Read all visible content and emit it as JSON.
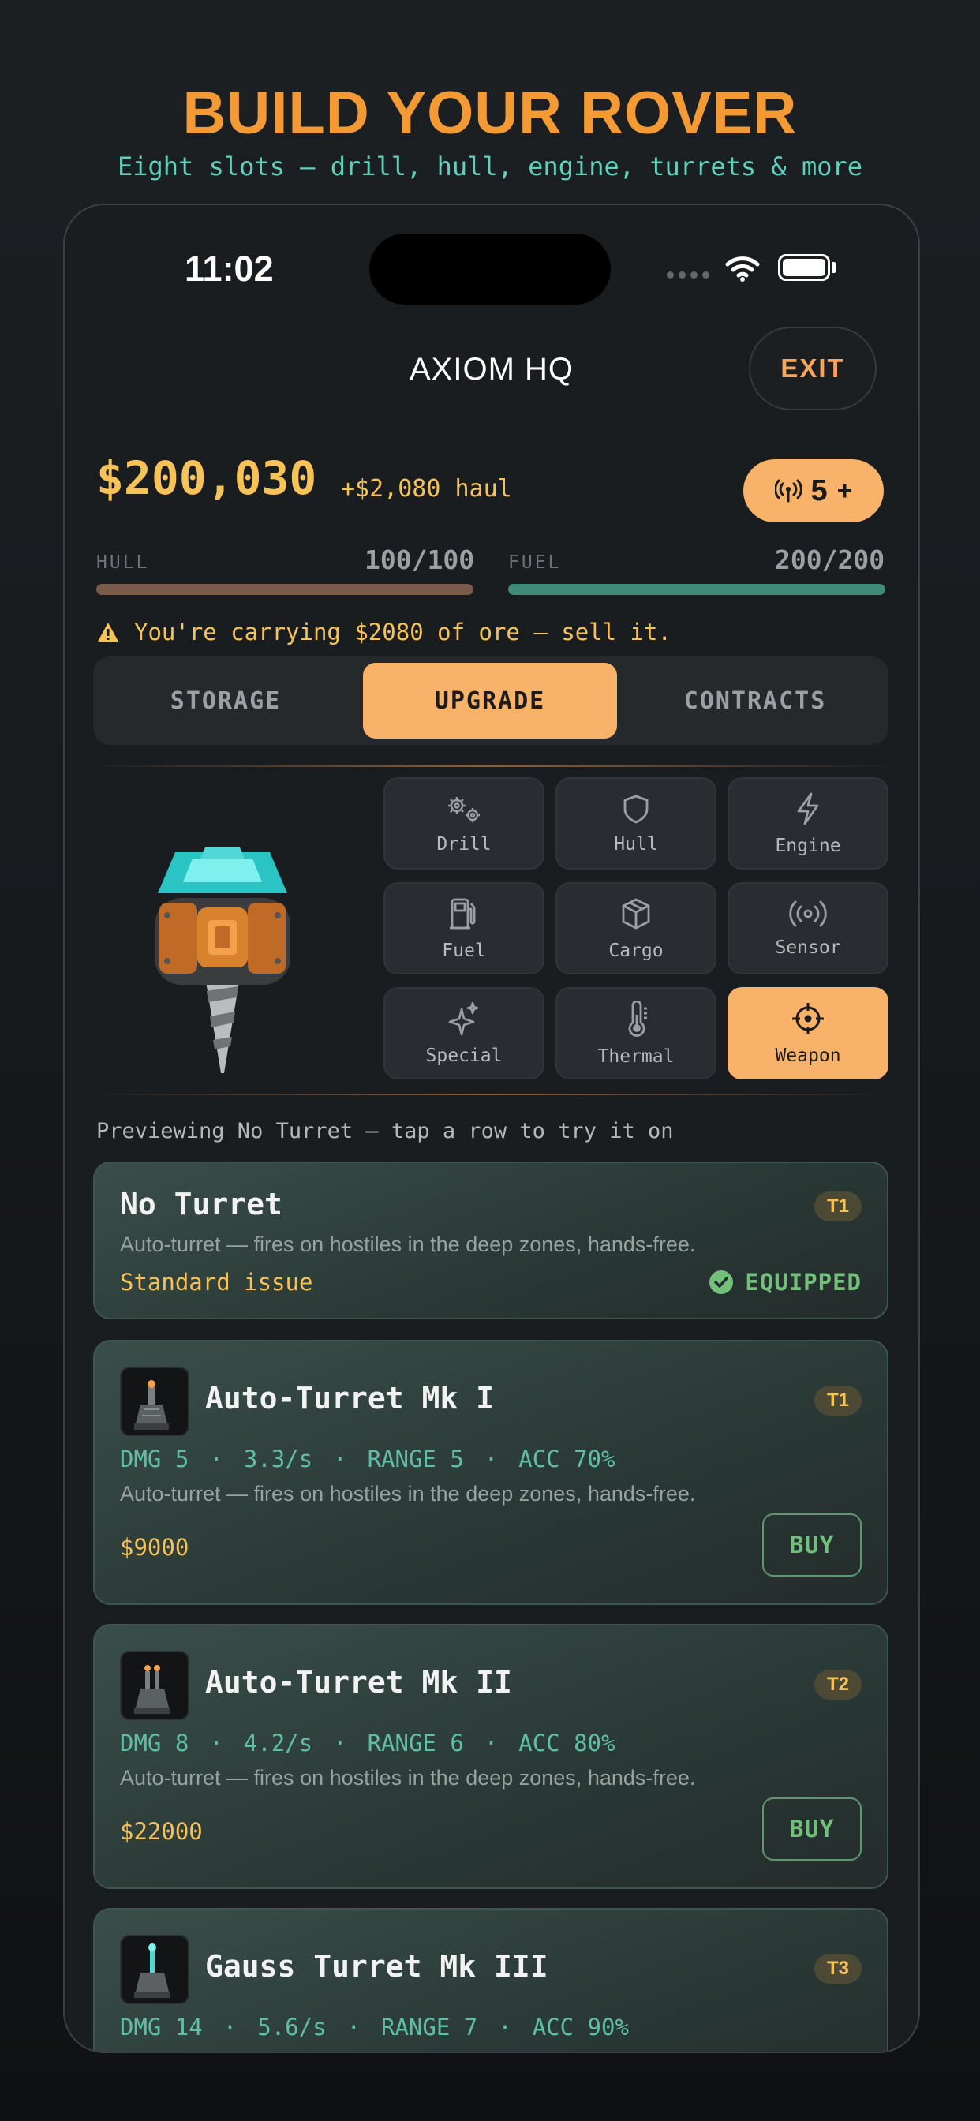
{
  "promo": {
    "title": "BUILD YOUR ROVER",
    "subtitle": "Eight slots — drill, hull, engine, turrets & more"
  },
  "status_bar": {
    "time": "11:02"
  },
  "nav": {
    "title": "AXIOM HQ",
    "exit_label": "EXIT"
  },
  "wallet": {
    "balance": "$200,030",
    "haul": "+$2,080 haul",
    "signal_count": "5",
    "signal_plus": "+"
  },
  "meters": {
    "hull": {
      "label": "HULL",
      "value": "100/100",
      "fraction": 1.0,
      "color": "#7a5a4a"
    },
    "fuel": {
      "label": "FUEL",
      "value": "200/200",
      "fraction": 1.0,
      "color": "#3f8a78"
    }
  },
  "warning": {
    "text": "You're carrying $2080 of ore — sell it.",
    "icon": "warning-triangle-icon"
  },
  "tabs": [
    {
      "label": "STORAGE",
      "active": false
    },
    {
      "label": "UPGRADE",
      "active": true
    },
    {
      "label": "CONTRACTS",
      "active": false
    }
  ],
  "slots": [
    {
      "label": "Drill",
      "icon": "gears-icon",
      "active": false
    },
    {
      "label": "Hull",
      "icon": "shield-icon",
      "active": false
    },
    {
      "label": "Engine",
      "icon": "lightning-icon",
      "active": false
    },
    {
      "label": "Fuel",
      "icon": "fuel-pump-icon",
      "active": false
    },
    {
      "label": "Cargo",
      "icon": "box-icon",
      "active": false
    },
    {
      "label": "Sensor",
      "icon": "broadcast-icon",
      "active": false
    },
    {
      "label": "Special",
      "icon": "sparkle-icon",
      "active": false
    },
    {
      "label": "Thermal",
      "icon": "thermometer-icon",
      "active": false
    },
    {
      "label": "Weapon",
      "icon": "crosshair-icon",
      "active": true
    }
  ],
  "preview_text": "Previewing No Turret — tap a row to try it on",
  "items": [
    {
      "name": "No Turret",
      "tier": "T1",
      "description": "Auto-turret — fires on hostiles in the deep zones, hands-free.",
      "price": "Standard issue",
      "status": "EQUIPPED"
    },
    {
      "name": "Auto-Turret Mk I",
      "tier": "T1",
      "stats": {
        "dmg": "DMG 5",
        "rate": "3.3/s",
        "range": "RANGE 5",
        "acc": "ACC 70%"
      },
      "description": "Auto-turret — fires on hostiles in the deep zones, hands-free.",
      "price": "$9000",
      "action": "BUY"
    },
    {
      "name": "Auto-Turret Mk II",
      "tier": "T2",
      "stats": {
        "dmg": "DMG 8",
        "rate": "4.2/s",
        "range": "RANGE 6",
        "acc": "ACC 80%"
      },
      "description": "Auto-turret — fires on hostiles in the deep zones, hands-free.",
      "price": "$22000",
      "action": "BUY"
    },
    {
      "name": "Gauss Turret Mk III",
      "tier": "T3",
      "stats": {
        "dmg": "DMG 14",
        "rate": "5.6/s",
        "range": "RANGE 7",
        "acc": "ACC 90%"
      }
    }
  ],
  "stat_separator": "·"
}
